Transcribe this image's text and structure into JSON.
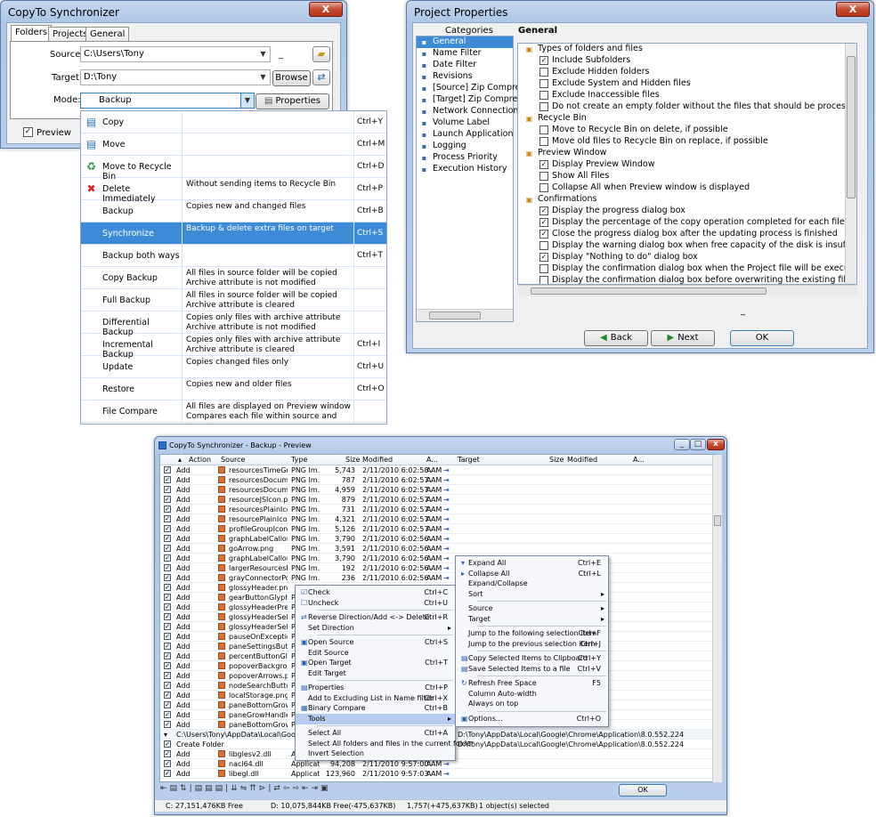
{
  "sync_window": {
    "title": "CopyTo Synchronizer",
    "close_label": "X",
    "tabs": [
      "Folders",
      "Projects",
      "General"
    ],
    "source_label": "Source:",
    "source_value": "C:\\Users\\Tony",
    "target_label": "Target:",
    "target_value": "D:\\Tony",
    "browse_label": "Browse",
    "mode_label": "Mode:",
    "mode_value": "Backup",
    "properties_label": "Properties",
    "preview_label": "Preview",
    "dash": "_"
  },
  "mode_list": [
    {
      "icon": "copy-icon",
      "glyph": "▤",
      "name": "Copy",
      "desc1": "",
      "desc2": "",
      "key": "Ctrl+Y"
    },
    {
      "icon": "move-icon",
      "glyph": "▤",
      "name": "Move",
      "desc1": "",
      "desc2": "",
      "key": "Ctrl+M"
    },
    {
      "icon": "recycle-bin-icon",
      "glyph": "♻",
      "name": "Move to Recycle Bin",
      "desc1": "",
      "desc2": "",
      "key": "Ctrl+D"
    },
    {
      "icon": "delete-x-icon",
      "glyph": "✖",
      "name": "Delete Immediately",
      "desc1": "Without sending items to Recycle Bin",
      "desc2": "",
      "key": "Ctrl+P"
    },
    {
      "icon": "",
      "glyph": "",
      "name": "Backup",
      "desc1": "Copies new and changed files",
      "desc2": "",
      "key": "Ctrl+B"
    },
    {
      "icon": "",
      "glyph": "",
      "name": "Synchronize",
      "desc1": "Backup & delete extra files on target",
      "desc2": "",
      "key": "Ctrl+S",
      "selected": true
    },
    {
      "icon": "",
      "glyph": "",
      "name": "Backup both ways",
      "desc1": "",
      "desc2": "",
      "key": "Ctrl+T"
    },
    {
      "icon": "",
      "glyph": "",
      "name": "Copy Backup",
      "desc1": "All files in source folder will be copied",
      "desc2": "Archive attribute is not modified",
      "key": ""
    },
    {
      "icon": "",
      "glyph": "",
      "name": "Full Backup",
      "desc1": "All files in source folder will be copied",
      "desc2": "Archive attribute is cleared",
      "key": ""
    },
    {
      "icon": "",
      "glyph": "",
      "name": "Differential Backup",
      "desc1": "Copies only files with archive attribute",
      "desc2": "Archive attribute is not modified",
      "key": ""
    },
    {
      "icon": "",
      "glyph": "",
      "name": "Incremental Backup",
      "desc1": "Copies only files with archive attribute",
      "desc2": "Archive attribute is cleared",
      "key": "Ctrl+I"
    },
    {
      "icon": "",
      "glyph": "",
      "name": "Update",
      "desc1": "Copies changed files only",
      "desc2": "",
      "key": "Ctrl+U"
    },
    {
      "icon": "",
      "glyph": "",
      "name": "Restore",
      "desc1": "Copies new and older files",
      "desc2": "",
      "key": "Ctrl+O"
    },
    {
      "icon": "",
      "glyph": "",
      "name": "File Compare",
      "desc1": "All files are displayed on Preview window",
      "desc2": "Compares each file within source and target",
      "key": ""
    }
  ],
  "project_window": {
    "title": "Project Properties",
    "close_label": "X",
    "categories_header": "Categories",
    "general_header": "General",
    "categories": [
      "General",
      "Name Filter",
      "Date Filter",
      "Revisions",
      "[Source] Zip Compress",
      "[Target] Zip Compress",
      "Network Connection",
      "Volume Label",
      "Launch Application",
      "Logging",
      "Process Priority",
      "Execution History"
    ],
    "settings": [
      {
        "type": "h",
        "text": "Types of folders and files"
      },
      {
        "type": "i",
        "checked": true,
        "text": "Include Subfolders"
      },
      {
        "type": "i",
        "checked": false,
        "text": "Exclude Hidden folders"
      },
      {
        "type": "i",
        "checked": false,
        "text": "Exclude System and Hidden files"
      },
      {
        "type": "i",
        "checked": false,
        "text": "Exclude Inaccessible files"
      },
      {
        "type": "i",
        "checked": false,
        "text": "Do not create an empty folder without the files that should be processed"
      },
      {
        "type": "h",
        "text": "Recycle Bin"
      },
      {
        "type": "i",
        "checked": false,
        "text": "Move to Recycle Bin on delete, if possible"
      },
      {
        "type": "i",
        "checked": false,
        "text": "Move old files to Recycle Bin on replace, if possible"
      },
      {
        "type": "h",
        "text": "Preview Window"
      },
      {
        "type": "i",
        "checked": true,
        "text": "Display Preview Window"
      },
      {
        "type": "i",
        "checked": false,
        "text": "Show All Files"
      },
      {
        "type": "i",
        "checked": false,
        "text": "Collapse All when Preview window is displayed"
      },
      {
        "type": "h",
        "text": "Confirmations"
      },
      {
        "type": "i",
        "checked": true,
        "text": "Display the progress dialog box"
      },
      {
        "type": "i",
        "checked": true,
        "text": "Display the percentage of the copy operation completed for each file(Not avai"
      },
      {
        "type": "i",
        "checked": true,
        "text": "Close the progress dialog box after the updating process is finished"
      },
      {
        "type": "i",
        "checked": false,
        "text": "Display the warning dialog box when free capacity of the disk is insufficient"
      },
      {
        "type": "i",
        "checked": true,
        "text": "Display \"Nothing to do\" dialog box"
      },
      {
        "type": "i",
        "checked": false,
        "text": "Display the confirmation dialog box when the Project file will be executed"
      },
      {
        "type": "i",
        "checked": false,
        "text": "Display the confirmation dialog box before overwriting the existing file(Not ava"
      }
    ],
    "back_label": "Back",
    "next_label": "Next",
    "ok_label": "OK",
    "dash": "_"
  },
  "preview_window": {
    "title": "CopyTo Synchronizer - Backup - Preview",
    "headers": {
      "action": "Action",
      "source": "Source",
      "type": "Type",
      "size": "Size",
      "modified": "Modified",
      "attr": "A...",
      "target": "Target",
      "tsize": "Size",
      "tmodified": "Modified",
      "tattr": "A..."
    },
    "rows": [
      {
        "action": "Add",
        "name": "resourcesTimeGra...",
        "type": "PNG Im...",
        "size": "5,743",
        "mod": "2/11/2010 6:02:58 AM",
        "a": "A"
      },
      {
        "action": "Add",
        "name": "resourcesDocumen...",
        "type": "PNG Im...",
        "size": "787",
        "mod": "2/11/2010 6:02:57 AM",
        "a": "A"
      },
      {
        "action": "Add",
        "name": "resourcesDocumen...",
        "type": "PNG Im...",
        "size": "4,959",
        "mod": "2/11/2010 6:02:57 AM",
        "a": "A"
      },
      {
        "action": "Add",
        "name": "resourceJSIcon.png",
        "type": "PNG Im...",
        "size": "879",
        "mod": "2/11/2010 6:02:57 AM",
        "a": "A"
      },
      {
        "action": "Add",
        "name": "resourcesPlainIcon...",
        "type": "PNG Im...",
        "size": "731",
        "mod": "2/11/2010 6:02:57 AM",
        "a": "A"
      },
      {
        "action": "Add",
        "name": "resourcePlainIcon...",
        "type": "PNG Im...",
        "size": "4,321",
        "mod": "2/11/2010 6:02:57 AM",
        "a": "A"
      },
      {
        "action": "Add",
        "name": "profileGroupIcon...",
        "type": "PNG Im...",
        "size": "5,126",
        "mod": "2/11/2010 6:02:57 AM",
        "a": "A"
      },
      {
        "action": "Add",
        "name": "graphLabelCallou...",
        "type": "PNG Im...",
        "size": "3,790",
        "mod": "2/11/2010 6:02:56 AM",
        "a": "A"
      },
      {
        "action": "Add",
        "name": "goArrow.png",
        "type": "PNG Im...",
        "size": "3,591",
        "mod": "2/11/2010 6:02:56 AM",
        "a": "A"
      },
      {
        "action": "Add",
        "name": "graphLabelCallou...",
        "type": "PNG Im...",
        "size": "3,790",
        "mod": "2/11/2010 6:02:56 AM",
        "a": "A"
      },
      {
        "action": "Add",
        "name": "largerResourcesB...",
        "type": "PNG Im...",
        "size": "192",
        "mod": "2/11/2010 6:02:56 AM",
        "a": "A"
      },
      {
        "action": "Add",
        "name": "grayConnectorPoi...",
        "type": "PNG Im...",
        "size": "236",
        "mod": "2/11/2010 6:02:56 AM",
        "a": "A"
      },
      {
        "action": "Add",
        "name": "glossyHeader.png",
        "type": "",
        "size": "",
        "mod": "",
        "a": ""
      },
      {
        "action": "Add",
        "name": "gearButtonGlyph...",
        "type": "PI",
        "size": "",
        "mod": "",
        "a": ""
      },
      {
        "action": "Add",
        "name": "glossyHeaderPres...",
        "type": "PI",
        "size": "",
        "mod": "",
        "a": ""
      },
      {
        "action": "Add",
        "name": "glossyHeaderSele...",
        "type": "PI",
        "size": "",
        "mod": "",
        "a": ""
      },
      {
        "action": "Add",
        "name": "glossyHeaderSele...",
        "type": "PI",
        "size": "",
        "mod": "",
        "a": ""
      },
      {
        "action": "Add",
        "name": "pauseOnExceptio...",
        "type": "PI",
        "size": "",
        "mod": "",
        "a": ""
      },
      {
        "action": "Add",
        "name": "paneSettingsButt...",
        "type": "PI",
        "size": "",
        "mod": "",
        "a": ""
      },
      {
        "action": "Add",
        "name": "percentButtonGly...",
        "type": "PI",
        "size": "",
        "mod": "",
        "a": ""
      },
      {
        "action": "Add",
        "name": "popoverBackgrou...",
        "type": "PI",
        "size": "",
        "mod": "",
        "a": ""
      },
      {
        "action": "Add",
        "name": "popoverArrows.png",
        "type": "PI",
        "size": "",
        "mod": "",
        "a": ""
      },
      {
        "action": "Add",
        "name": "nodeSearchButto...",
        "type": "PI",
        "size": "",
        "mod": "",
        "a": ""
      },
      {
        "action": "Add",
        "name": "localStorage.png",
        "type": "PI",
        "size": "",
        "mod": "",
        "a": ""
      },
      {
        "action": "Add",
        "name": "paneBottomGrow...",
        "type": "PI",
        "size": "",
        "mod": "",
        "a": ""
      },
      {
        "action": "Add",
        "name": "paneGrowHandle...",
        "type": "PI",
        "size": "",
        "mod": "",
        "a": ""
      },
      {
        "action": "Add",
        "name": "paneBottomGrow...",
        "type": "PI",
        "size": "",
        "mod": "",
        "a": ""
      }
    ],
    "folder_path": "C:\\Users\\Tony\\AppData\\Local\\Google\\Chrom",
    "target_path": "D:\\Tony\\AppData\\Local\\Google\\Chrome\\Application\\8.0.552.224",
    "target_path2": "D:\\Tony\\AppData\\Local\\Google\\Chrome\\Application\\8.0.552.224",
    "create_folder": "Create Folder",
    "bottom_rows": [
      {
        "action": "Add",
        "name": "libglesv2.dll",
        "type": "Applicat...",
        "size": "2,346,496",
        "mod": "2/11/2010 9:58:17 AM",
        "a": "A"
      },
      {
        "action": "Add",
        "name": "nacl64.dll",
        "type": "Applicat...",
        "size": "94,208",
        "mod": "2/11/2010 9:57:00 AM",
        "a": "A"
      },
      {
        "action": "Add",
        "name": "libegl.dll",
        "type": "Applicat...",
        "size": "123,960",
        "mod": "2/11/2010 9:57:03 AM",
        "a": "A"
      }
    ],
    "menu1": [
      {
        "label": "Check",
        "key": "Ctrl+C",
        "ic": "☑"
      },
      {
        "label": "Uncheck",
        "key": "Ctrl+U",
        "ic": "☐"
      },
      {
        "sep": true
      },
      {
        "label": "Reverse Direction/Add <-> Delete",
        "key": "Ctrl+R",
        "ic": "⇄"
      },
      {
        "label": "Set Direction",
        "key": "",
        "arrow": "▸"
      },
      {
        "sep": true
      },
      {
        "label": "Open Source",
        "key": "Ctrl+S",
        "ic": "▣"
      },
      {
        "label": "Edit Source",
        "key": "",
        "ic": ""
      },
      {
        "label": "Open Target",
        "key": "Ctrl+T",
        "ic": "▣"
      },
      {
        "label": "Edit Target",
        "key": "",
        "ic": ""
      },
      {
        "sep": true
      },
      {
        "label": "Properties",
        "key": "Ctrl+P",
        "ic": "▤"
      },
      {
        "label": "Add to Excluding List in Name filter",
        "key": "Ctrl+X",
        "ic": ""
      },
      {
        "label": "Binary Compare",
        "key": "Ctrl+B",
        "ic": "▦"
      },
      {
        "label": "Tools",
        "key": "",
        "arrow": "▸",
        "hl": true
      },
      {
        "sep": true
      },
      {
        "label": "Select All",
        "key": "Ctrl+A",
        "ic": ""
      },
      {
        "label": "Select All folders and files in the current folder",
        "key": "",
        "ic": ""
      },
      {
        "label": "Invert Selection",
        "key": "",
        "ic": ""
      }
    ],
    "menu2": [
      {
        "label": "Expand All",
        "key": "Ctrl+E",
        "ic": "▾"
      },
      {
        "label": "Collapse All",
        "key": "Ctrl+L",
        "ic": "▸"
      },
      {
        "label": "Expand/Collapse",
        "key": "",
        "ic": ""
      },
      {
        "label": "Sort",
        "key": "",
        "arrow": "▸"
      },
      {
        "sep": true
      },
      {
        "label": "Source",
        "key": "",
        "arrow": "▸"
      },
      {
        "label": "Target",
        "key": "",
        "arrow": "▸"
      },
      {
        "sep": true
      },
      {
        "label": "Jump to the following selection item",
        "key": "Ctrl+F",
        "ic": ""
      },
      {
        "label": "Jump to the previous selection item",
        "key": "Ctrl+J",
        "ic": ""
      },
      {
        "sep": true
      },
      {
        "label": "Copy Selected Items to Clipboard",
        "key": "Ctrl+Y",
        "ic": "▤"
      },
      {
        "label": "Save Selected Items to a file",
        "key": "Ctrl+V",
        "ic": "▤"
      },
      {
        "sep": true
      },
      {
        "label": "Refresh Free Space",
        "key": "F5",
        "ic": "↻"
      },
      {
        "label": "Column Auto-width",
        "key": "",
        "ic": ""
      },
      {
        "label": "Always on top",
        "key": "",
        "ic": ""
      },
      {
        "sep": true
      },
      {
        "label": "Options...",
        "key": "Ctrl+O",
        "ic": "▣"
      }
    ],
    "ok_label": "OK",
    "status": {
      "c_drive": "C: 27,151,476KB Free",
      "d_drive": "D: 10,075,844KB Free(-475,637KB)",
      "counts": "1,757(+475,637KB)",
      "selected": "1 object(s) selected"
    }
  }
}
